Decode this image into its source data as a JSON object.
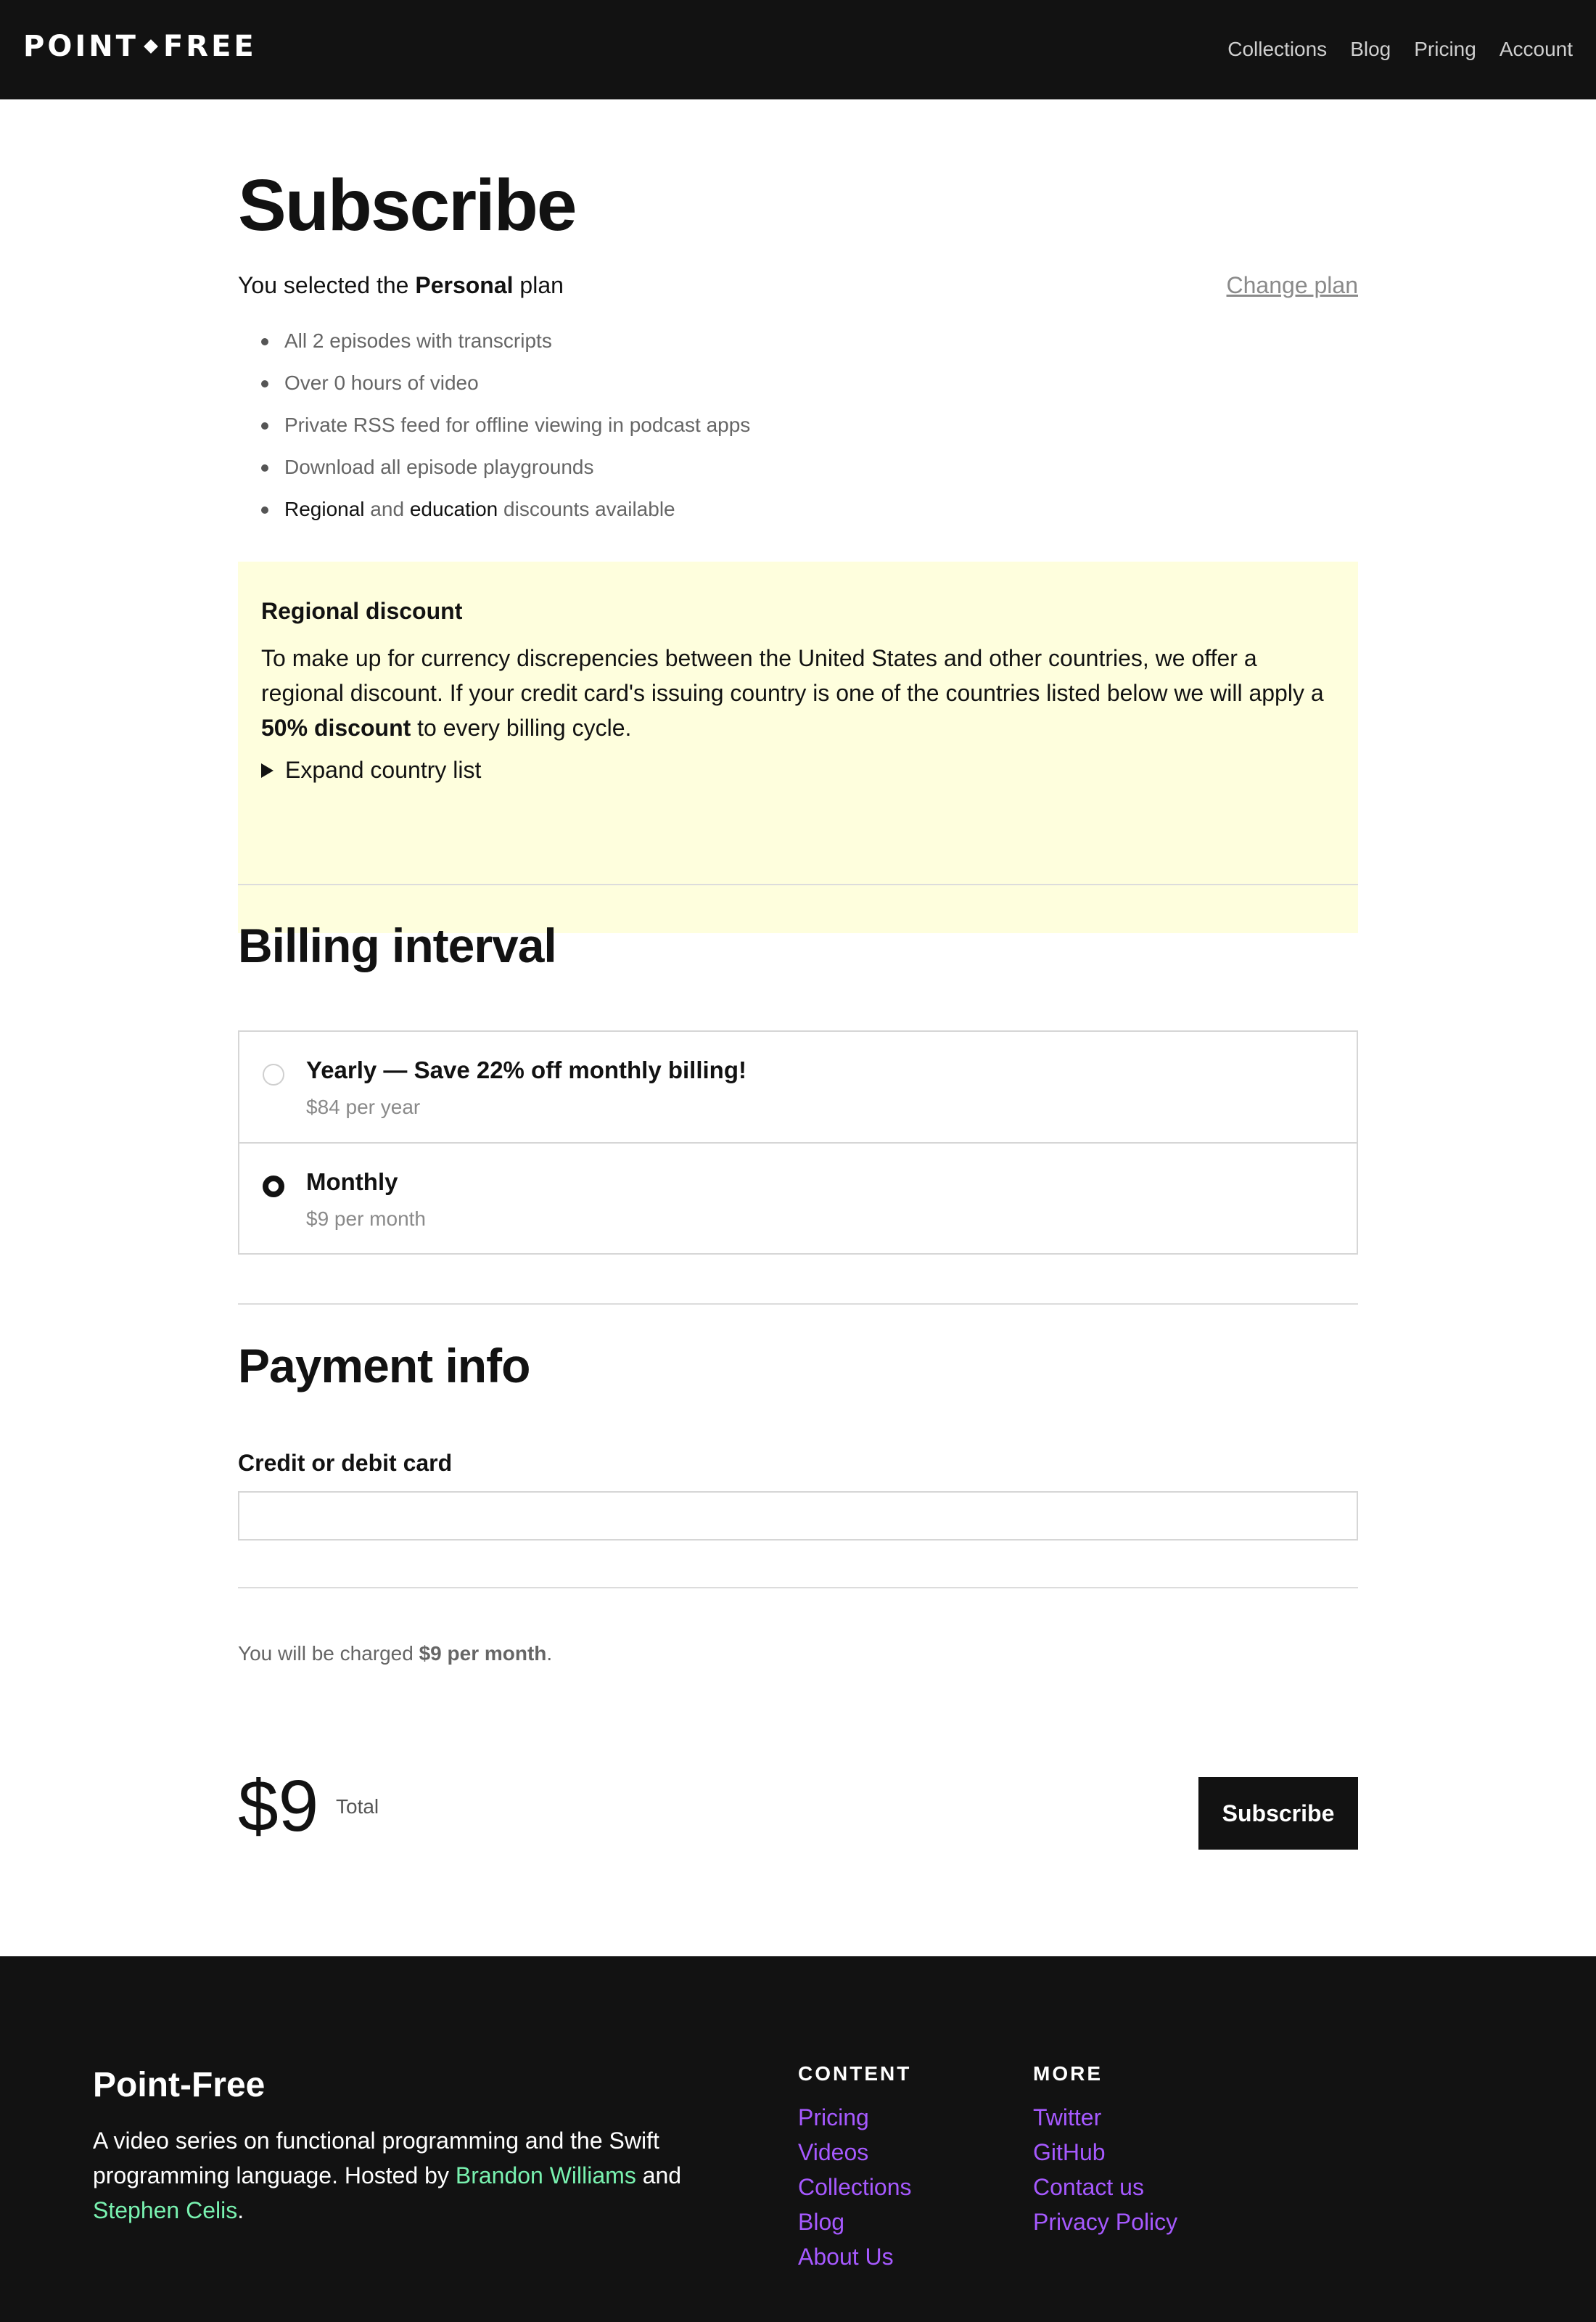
{
  "header": {
    "logo_left": "POINT",
    "logo_right": "FREE",
    "nav": [
      "Collections",
      "Blog",
      "Pricing",
      "Account"
    ]
  },
  "main": {
    "title": "Subscribe",
    "plan_prefix": "You selected the ",
    "plan_name": "Personal",
    "plan_suffix": " plan",
    "change_plan": "Change plan",
    "features": [
      "All 2 episodes with transcripts",
      "Over 0 hours of video",
      "Private RSS feed for offline viewing in podcast apps",
      "Download all episode playgrounds"
    ],
    "discount_feature": {
      "regional": "Regional",
      "and": " and ",
      "education": "education",
      "rest": " discounts available"
    },
    "regional_discount": {
      "heading": "Regional discount",
      "text_before": "To make up for currency discrepencies between the United States and other countries, we offer a regional discount. If your credit card's issuing country is one of the countries listed below we will apply a ",
      "bold": "50% discount",
      "text_after": " to every billing cycle.",
      "expand": "Expand country list"
    },
    "billing": {
      "heading": "Billing interval",
      "options": [
        {
          "title": "Yearly — Save 22% off monthly billing!",
          "sub": "$84 per year",
          "selected": false
        },
        {
          "title": "Monthly",
          "sub": "$9 per month",
          "selected": true
        }
      ]
    },
    "payment": {
      "heading": "Payment info",
      "card_label": "Credit or debit card",
      "card_value": ""
    },
    "charge": {
      "prefix": "You will be charged ",
      "amount": "$9 per month",
      "suffix": "."
    },
    "total": {
      "amount": "$9",
      "label": "Total",
      "button": "Subscribe"
    }
  },
  "footer": {
    "brand": "Point-Free",
    "desc_before": "A video series on functional programming and the Swift programming language. Hosted by ",
    "host1": "Brandon Williams",
    "and": " and ",
    "host2": "Stephen Celis",
    "end": ".",
    "content_heading": "CONTENT",
    "content_links": [
      "Pricing",
      "Videos",
      "Collections",
      "Blog",
      "About Us"
    ],
    "more_heading": "MORE",
    "more_links": [
      "Twitter",
      "GitHub",
      "Contact us",
      "Privacy Policy"
    ]
  },
  "colors": {
    "dark": "#121212",
    "discount_bg": "#fefedd",
    "link_purple": "#a659ff",
    "link_green": "#79f2b0"
  }
}
